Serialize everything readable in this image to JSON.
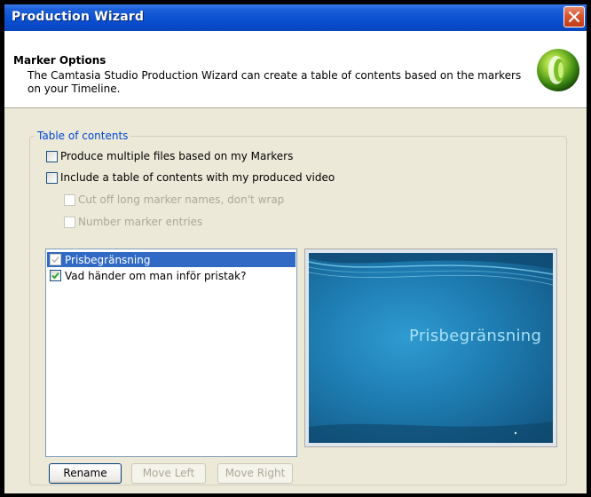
{
  "window": {
    "title": "Production Wizard"
  },
  "header": {
    "title": "Marker Options",
    "description": "The Camtasia Studio Production Wizard can create a table of contents based on the markers on your Timeline."
  },
  "toc": {
    "group_label": "Table of contents",
    "options": [
      {
        "label": "Produce multiple files based on my Markers",
        "checked": false,
        "enabled": true
      },
      {
        "label": "Include a table of contents with my produced video",
        "checked": false,
        "enabled": true
      },
      {
        "label": "Cut off long marker names, don't wrap",
        "checked": false,
        "enabled": false
      },
      {
        "label": "Number marker entries",
        "checked": false,
        "enabled": false
      }
    ],
    "markers": [
      {
        "label": "Prisbegränsning",
        "checked": true,
        "selected": true
      },
      {
        "label": "Vad händer om man inför pristak?",
        "checked": true,
        "selected": false
      }
    ],
    "preview": {
      "slide_title": "Prisbegränsning"
    }
  },
  "buttons": {
    "rename": "Rename",
    "move_left": "Move Left",
    "move_right": "Move Right"
  },
  "colors": {
    "titlebar": "#0a4fd0",
    "group_label": "#0046d5",
    "selection": "#316ac5"
  }
}
